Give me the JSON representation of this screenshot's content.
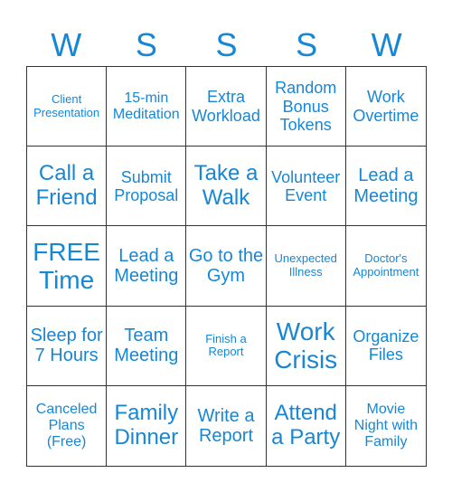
{
  "header": [
    "W",
    "S",
    "S",
    "S",
    "W"
  ],
  "cells": [
    {
      "text": "Client Presentation",
      "size": "s1"
    },
    {
      "text": "15-min Meditation",
      "size": "s2"
    },
    {
      "text": "Extra Workload",
      "size": "s3"
    },
    {
      "text": "Random Bonus Tokens",
      "size": "s3"
    },
    {
      "text": "Work Overtime",
      "size": "s3"
    },
    {
      "text": "Call a Friend",
      "size": "s5"
    },
    {
      "text": "Submit Proposal",
      "size": "s3"
    },
    {
      "text": "Take a Walk",
      "size": "s5"
    },
    {
      "text": "Volunteer Event",
      "size": "s3"
    },
    {
      "text": "Lead a Meeting",
      "size": "s4"
    },
    {
      "text": "FREE Time",
      "size": "s6"
    },
    {
      "text": "Lead a Meeting",
      "size": "s4"
    },
    {
      "text": "Go to the Gym",
      "size": "s4"
    },
    {
      "text": "Unexpected Illness",
      "size": "s1"
    },
    {
      "text": "Doctor's Appointment",
      "size": "s1"
    },
    {
      "text": "Sleep for 7 Hours",
      "size": "s4"
    },
    {
      "text": "Team Meeting",
      "size": "s4"
    },
    {
      "text": "Finish a Report",
      "size": "s1"
    },
    {
      "text": "Work Crisis",
      "size": "s6"
    },
    {
      "text": "Organize Files",
      "size": "s3"
    },
    {
      "text": "Canceled Plans (Free)",
      "size": "s2"
    },
    {
      "text": "Family Dinner",
      "size": "s5"
    },
    {
      "text": "Write a Report",
      "size": "s4"
    },
    {
      "text": "Attend a Party",
      "size": "s5"
    },
    {
      "text": "Movie Night with Family",
      "size": "s2"
    }
  ]
}
